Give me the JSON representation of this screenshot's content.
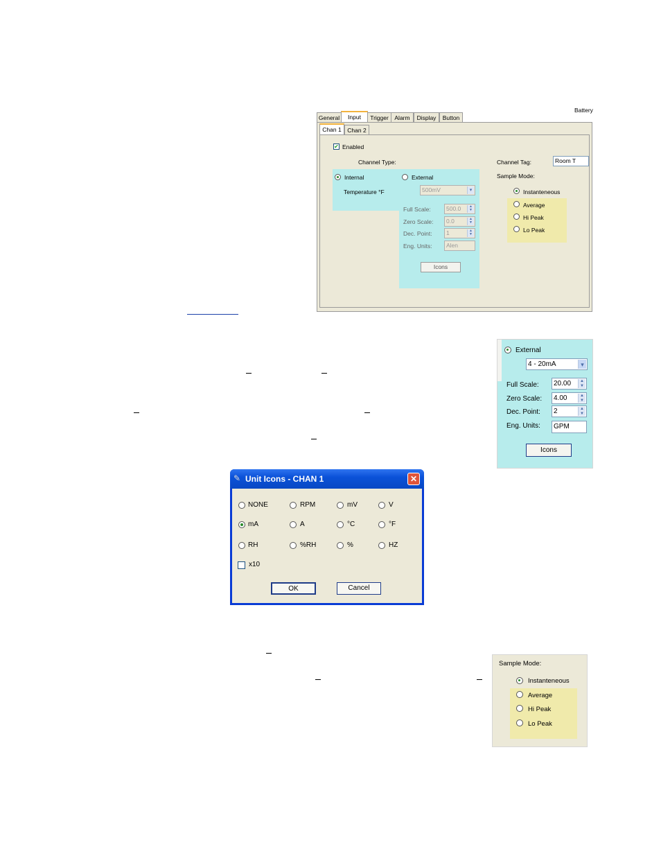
{
  "panel1": {
    "corner_label": "Battery",
    "tabs": [
      "General",
      "Input",
      "Trigger",
      "Alarm",
      "Display",
      "Button"
    ],
    "subtabs": [
      "Chan 1",
      "Chan 2"
    ],
    "enabled_label": "Enabled",
    "channel_type_label": "Channel Type:",
    "internal_label": "Internal",
    "temperature_label": "Temperature °F",
    "external_label": "External",
    "range_value": "500mV",
    "full_scale_label": "Full Scale:",
    "full_scale_value": "500.0",
    "zero_scale_label": "Zero Scale:",
    "zero_scale_value": "0.0",
    "dec_point_label": "Dec. Point:",
    "dec_point_value": "1",
    "eng_units_label": "Eng. Units:",
    "eng_units_value": "Alen",
    "icons_label": "Icons",
    "channel_tag_label": "Channel Tag:",
    "channel_tag_value": "Room T",
    "sample_mode_label": "Sample Mode:",
    "sample_modes": [
      "Instanteneous",
      "Average",
      "Hi Peak",
      "Lo Peak"
    ]
  },
  "panel2": {
    "external_label": "External",
    "range_value": "4 - 20mA",
    "full_scale_label": "Full Scale:",
    "full_scale_value": "20.00",
    "zero_scale_label": "Zero Scale:",
    "zero_scale_value": "4.00",
    "dec_point_label": "Dec. Point:",
    "dec_point_value": "2",
    "eng_units_label": "Eng. Units:",
    "eng_units_value": "GPM",
    "icons_label": "Icons"
  },
  "dialog": {
    "title": "Unit Icons - CHAN 1",
    "options": [
      "NONE",
      "RPM",
      "mV",
      "V",
      "mA",
      "A",
      "°C",
      "°F",
      "RH",
      "%RH",
      "%",
      "HZ"
    ],
    "selected": "mA",
    "x10_label": "x10",
    "ok_label": "OK",
    "cancel_label": "Cancel"
  },
  "panel3": {
    "sample_mode_label": "Sample Mode:",
    "sample_modes": [
      "Instanteneous",
      "Average",
      "Hi Peak",
      "Lo Peak"
    ],
    "selected": "Instanteneous"
  },
  "colors": {
    "panel_bg": "#ece9d8",
    "cyan_group": "#b7ecec",
    "yellow_group": "#f0eaab",
    "titlebar": "#0b52d8",
    "close_button": "#e0553a"
  }
}
